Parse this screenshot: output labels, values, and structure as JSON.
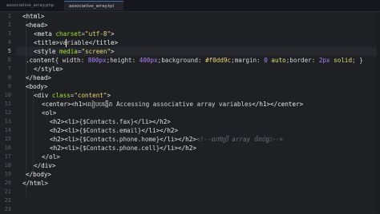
{
  "tabs": [
    {
      "label": "associative_array.php",
      "active": false
    },
    {
      "label": "associative_array.tpl",
      "active": true
    }
  ],
  "editor": {
    "active_line": 5,
    "line_numbers": [
      "1",
      "2",
      "3",
      "4",
      "5",
      "6",
      "7",
      "8",
      "9",
      "10",
      "11",
      "12",
      "13",
      "14",
      "15",
      "16",
      "17",
      "18",
      "19",
      "20",
      "21",
      "22",
      "23"
    ]
  },
  "code": {
    "l1": {
      "open": "<",
      "name": "html",
      "close": ">"
    },
    "l2": {
      "open": "<",
      "name": "head",
      "close": ">"
    },
    "l3": {
      "open": "<",
      "name": "meta",
      "attr": "charset",
      "eq": "=",
      "val": "\"utf-8\"",
      "close": ">"
    },
    "l4": {
      "a": "<title>",
      "b": "varia",
      "c": "ble",
      "d": "</title>"
    },
    "l5": {
      "open": "<",
      "name": "style",
      "attr": "media",
      "eq": "=",
      "val": "\"screen\"",
      "close": ">"
    },
    "l6": {
      "sel": ".content",
      "brace": "{",
      "p1": " width",
      "c1": ": ",
      "v1": "800px",
      "s1": ";",
      "p2": "height",
      "c2": ": ",
      "v2": "400px",
      "s2": ";",
      "p3": "background",
      "c3": ": ",
      "v3": "#f0dd9c",
      "s3": ";",
      "p4": "margin",
      "c4": ": ",
      "v4": "0",
      "v4b": " auto",
      "s4": ";",
      "p5": "border",
      "c5": ": ",
      "v5": "2px",
      "v5b": " solid",
      "s5": ";",
      "end": " }"
    },
    "l7": {
      "text": "</style>"
    },
    "l8": {
      "text": "</head>"
    },
    "l9": {
      "text": "<body>"
    },
    "l10": {
      "open": "<",
      "name": "div",
      "attr": "class",
      "eq": "=",
      "val": "\"content\"",
      "close": ">"
    },
    "l11": {
      "a": "<center><h1>",
      "b": "លៀបបង្កើត Accessing associative array variables",
      "c": "</h1></center>"
    },
    "l12": {
      "text": "<ol>"
    },
    "l13": {
      "a": "<h2><li>",
      "b": "{$Contacts.fax}",
      "c": "</li></h2>"
    },
    "l14": {
      "a": "<h2><li>",
      "b": "{$Contacts.email}",
      "c": "</li></h2>"
    },
    "l15": {
      "a": "<h2><li>",
      "b": "{$Contacts.phone.home}",
      "c": "</li></h2>",
      "cmt": "<!--ហៅប្រើ array ចំរាប់ផ្ទះ-->"
    },
    "l16": {
      "a": "<h2><li>",
      "b": "{$Contacts.phone.cell}",
      "c": "</li></h2>"
    },
    "l17": {
      "text": "</ol>"
    },
    "l18": {
      "text": "</div>"
    },
    "l19": {
      "text": "</body>"
    },
    "l20": {
      "text": "</html>"
    }
  },
  "colors": {
    "background": "#1f2024",
    "tag": "#e9e9e9",
    "attribute": "#a6e22e",
    "string": "#e6db74",
    "number": "#ae81ff",
    "comment": "#6f7179",
    "line_number": "#5b5e65"
  }
}
